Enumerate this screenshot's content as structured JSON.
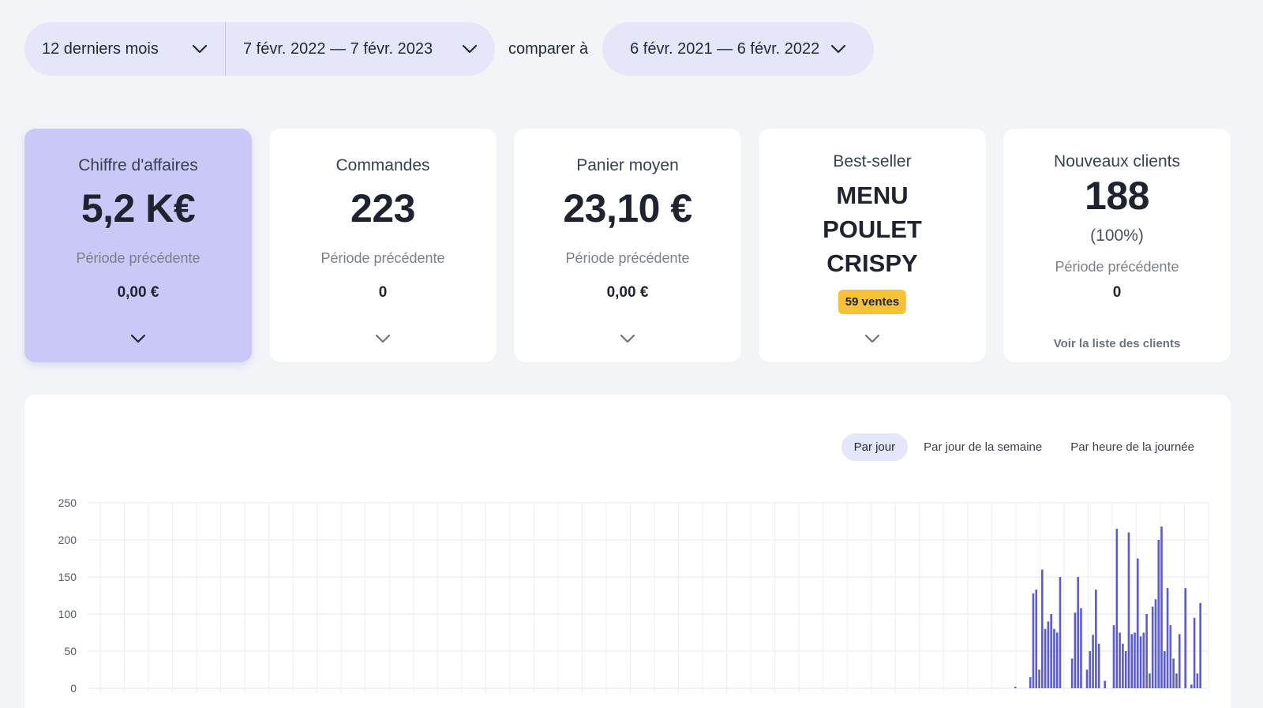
{
  "filters": {
    "period_label": "12 derniers mois",
    "date_range": "7 févr. 2022 — 7 févr. 2023",
    "compare_label": "comparer à",
    "compare_range": "6 févr. 2021 — 6 févr. 2022"
  },
  "cards": {
    "revenue": {
      "title": "Chiffre d'affaires",
      "value": "5,2 K€",
      "prev_label": "Période précédente",
      "prev_value": "0,00 €"
    },
    "orders": {
      "title": "Commandes",
      "value": "223",
      "prev_label": "Période précédente",
      "prev_value": "0"
    },
    "basket": {
      "title": "Panier moyen",
      "value": "23,10 €",
      "prev_label": "Période précédente",
      "prev_value": "0,00 €"
    },
    "bestseller": {
      "title": "Best-seller",
      "line1": "MENU",
      "line2": "POULET",
      "line3": "CRISPY",
      "badge": "59 ventes"
    },
    "clients": {
      "title": "Nouveaux clients",
      "value": "188",
      "percent": "(100%)",
      "prev_label": "Période précédente",
      "prev_value": "0",
      "link": "Voir la liste des clients"
    }
  },
  "tabs": [
    {
      "label": "Par jour",
      "active": true
    },
    {
      "label": "Par jour de la semaine",
      "active": false
    },
    {
      "label": "Par heure de la journée",
      "active": false
    }
  ],
  "colors": {
    "accent": "#5b5bd6",
    "active_card": "#c9c8f7",
    "pill": "#e6e6fb",
    "badge": "#f7c235"
  },
  "chart_data": {
    "type": "bar",
    "y_ticks": [
      0,
      50,
      100,
      150,
      200,
      250
    ],
    "ylim": [
      0,
      250
    ],
    "grid": true,
    "series": [
      {
        "values": [
          2,
          0,
          0,
          0,
          0,
          15,
          128,
          133,
          25,
          160,
          80,
          90,
          100,
          80,
          75,
          150,
          0,
          0,
          0,
          40,
          102,
          150,
          108,
          0,
          25,
          50,
          72,
          133,
          60,
          0,
          10,
          0,
          0,
          85,
          215,
          75,
          60,
          50,
          210,
          73,
          75,
          175,
          70,
          75,
          100,
          20,
          110,
          120,
          200,
          218,
          50,
          135,
          85,
          40,
          20,
          73,
          0,
          135,
          0,
          5,
          95,
          20,
          115,
          0,
          0
        ]
      }
    ]
  }
}
